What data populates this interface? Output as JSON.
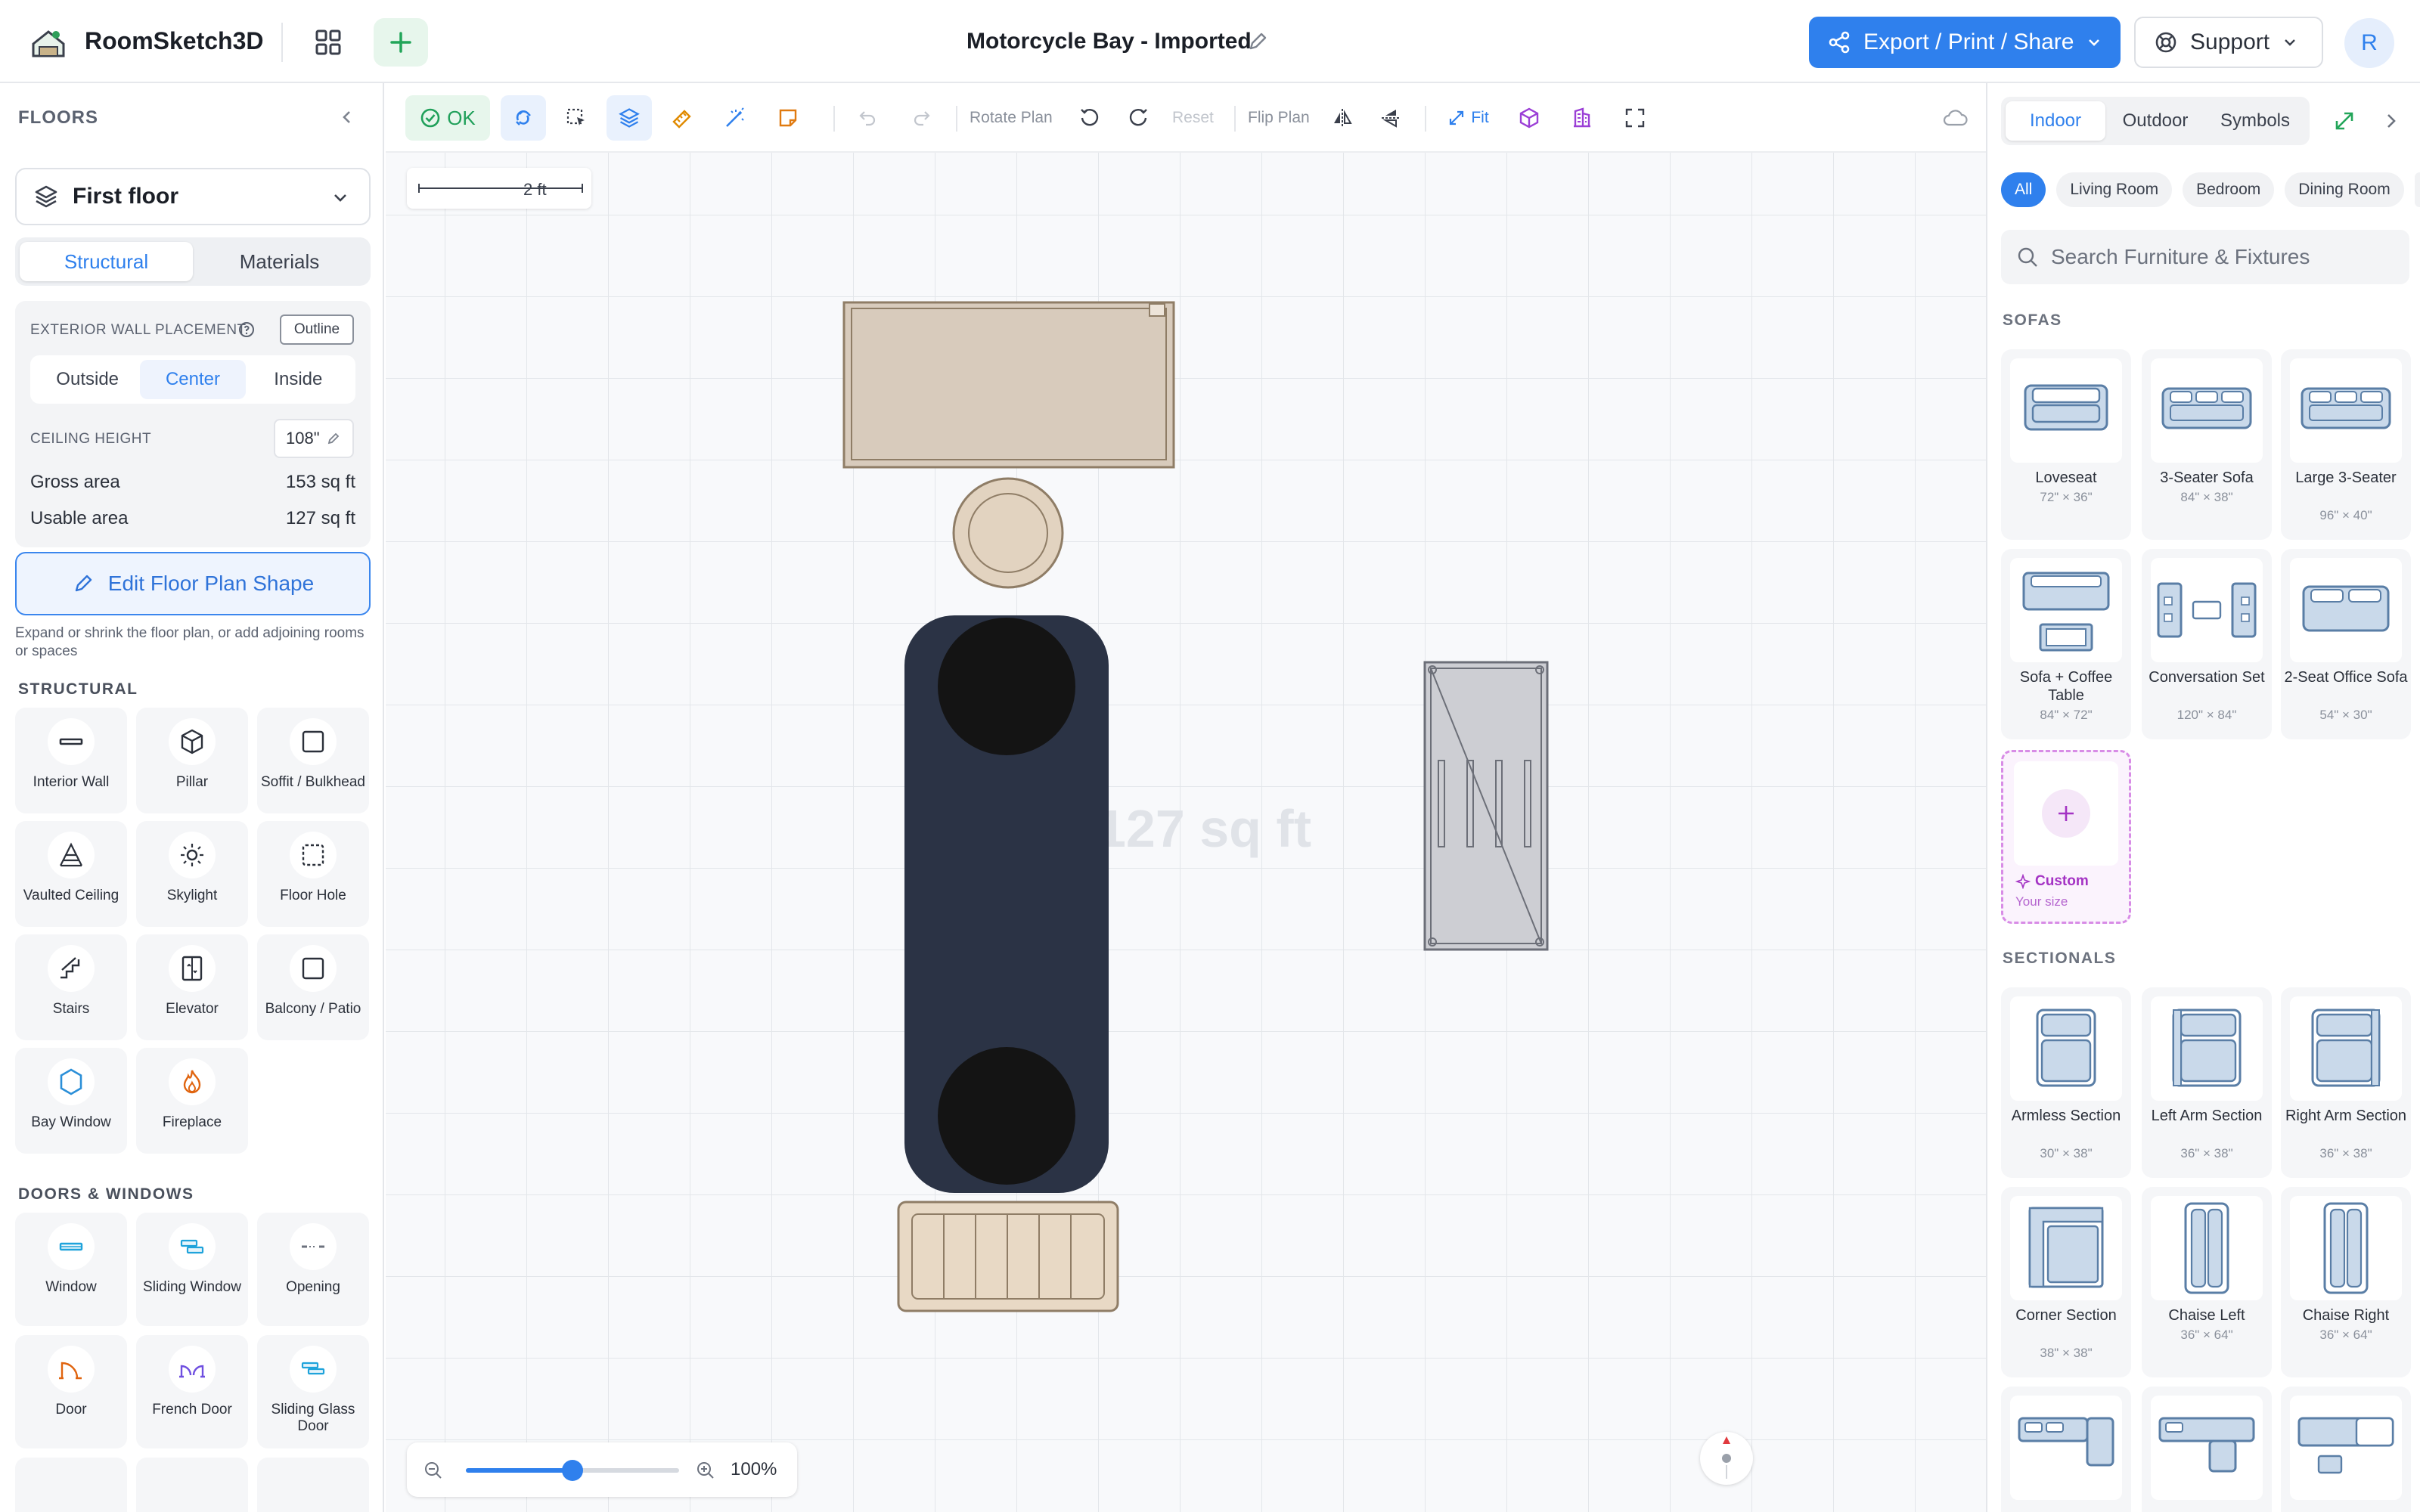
{
  "app": {
    "name": "RoomSketch3D",
    "doc_title": "Motorcycle Bay - Imported"
  },
  "header": {
    "export_label": "Export / Print / Share",
    "support_label": "Support",
    "avatar_initial": "R"
  },
  "left": {
    "title": "FLOORS",
    "floor": "First floor",
    "tabs": [
      "Structural",
      "Materials"
    ],
    "wall_placement_label": "EXTERIOR WALL PLACEMENT",
    "outline_label": "Outline",
    "placement": [
      "Outside",
      "Center",
      "Inside"
    ],
    "ceiling_label": "CEILING HEIGHT",
    "ceiling_value": "108\"",
    "gross_label": "Gross area",
    "gross_value": "153 sq ft",
    "usable_label": "Usable area",
    "usable_value": "127 sq ft",
    "edit_shape": "Edit Floor Plan Shape",
    "hint": "Expand or shrink the floor plan, or add adjoining rooms or spaces",
    "structural_title": "STRUCTURAL",
    "structural": [
      {
        "label": "Interior Wall",
        "icon": "interior-wall-icon"
      },
      {
        "label": "Pillar",
        "icon": "pillar-icon"
      },
      {
        "label": "Soffit / Bulkhead",
        "icon": "soffit-icon"
      },
      {
        "label": "Vaulted Ceiling",
        "icon": "vaulted-ceiling-icon"
      },
      {
        "label": "Skylight",
        "icon": "skylight-icon"
      },
      {
        "label": "Floor Hole",
        "icon": "floor-hole-icon"
      },
      {
        "label": "Stairs",
        "icon": "stairs-icon"
      },
      {
        "label": "Elevator",
        "icon": "elevator-icon"
      },
      {
        "label": "Balcony / Patio",
        "icon": "balcony-icon"
      },
      {
        "label": "Bay Window",
        "icon": "bay-window-icon"
      },
      {
        "label": "Fireplace",
        "icon": "fireplace-icon"
      }
    ],
    "doors_title": "DOORS & WINDOWS",
    "doors": [
      {
        "label": "Window",
        "icon": "window-icon"
      },
      {
        "label": "Sliding Window",
        "icon": "sliding-window-icon"
      },
      {
        "label": "Opening",
        "icon": "opening-icon"
      },
      {
        "label": "Door",
        "icon": "door-icon"
      },
      {
        "label": "French Door",
        "icon": "french-door-icon"
      },
      {
        "label": "Sliding Glass Door",
        "icon": "sliding-glass-door-icon"
      }
    ]
  },
  "toolbar": {
    "ok_label": "OK",
    "rotate_label": "Rotate Plan",
    "reset_label": "Reset",
    "flip_label": "Flip Plan",
    "fit_label": "Fit"
  },
  "canvas": {
    "scale_label": "2 ft",
    "area_watermark": "127 sq ft",
    "zoom_label": "100%",
    "zoom_level": 0.5
  },
  "right": {
    "tabs": [
      "Indoor",
      "Outdoor",
      "Symbols"
    ],
    "chips": [
      "All",
      "Living Room",
      "Bedroom",
      "Dining Room"
    ],
    "search_placeholder": "Search Furniture & Fixtures",
    "sofas_title": "SOFAS",
    "sofas": [
      {
        "name": "Loveseat",
        "dims": "72\" × 36\""
      },
      {
        "name": "3-Seater Sofa",
        "dims": "84\" × 38\""
      },
      {
        "name": "Large 3-Seater",
        "dims": "96\" × 40\""
      },
      {
        "name": "Sofa + Coffee Table",
        "dims": "84\" × 72\""
      },
      {
        "name": "Conversation Set",
        "dims": "120\" × 84\""
      },
      {
        "name": "2-Seat Office Sofa",
        "dims": "54\" × 30\""
      }
    ],
    "custom_label": "Custom",
    "custom_sub": "Your size",
    "sectionals_title": "SECTIONALS",
    "sectionals": [
      {
        "name": "Armless Section",
        "dims": "30\" × 38\""
      },
      {
        "name": "Left Arm Section",
        "dims": "36\" × 38\""
      },
      {
        "name": "Right Arm Section",
        "dims": "36\" × 38\""
      },
      {
        "name": "Corner Section",
        "dims": "38\" × 38\""
      },
      {
        "name": "Chaise Left",
        "dims": "36\" × 64\""
      },
      {
        "name": "Chaise Right",
        "dims": "36\" × 64\""
      }
    ]
  },
  "colors": {
    "accent": "#2f80ed",
    "ok_green": "#20a05a",
    "motorcycle": "#2b3345",
    "tire": "#141414",
    "bench": "#d9cbbb",
    "cabinet": "#c9cbd0"
  }
}
